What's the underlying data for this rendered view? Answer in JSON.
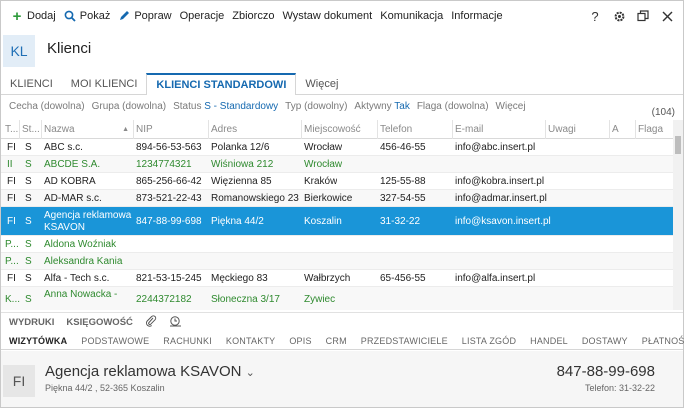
{
  "toolbar": {
    "add": "Dodaj",
    "show": "Pokaż",
    "fix": "Popraw",
    "operations": "Operacje",
    "bulk": "Zbiorczo",
    "issue": "Wystaw dokument",
    "communication": "Komunikacja",
    "info": "Informacje",
    "help": "?",
    "icons": [
      "plus-icon",
      "search-icon",
      "pencil-icon",
      "help-icon",
      "gear-icon",
      "restore-icon",
      "close-icon"
    ],
    "colors": {
      "add": "#2e9b3b",
      "accent": "#1569b0"
    }
  },
  "header": {
    "badge": "KL",
    "title": "Klienci"
  },
  "tabs": [
    {
      "label": "KLIENCI"
    },
    {
      "label": "MOI KLIENCI"
    },
    {
      "label": "KLIENCI STANDARDOWI"
    },
    {
      "label": "Więcej"
    }
  ],
  "filters": {
    "cecha": "Cecha (dowolna)",
    "grupa": "Grupa (dowolna)",
    "status_label": "Status",
    "status_value": "S - Standardowy",
    "typ": "Typ (dowolny)",
    "aktywny_label": "Aktywny",
    "aktywny_value": "Tak",
    "flaga": "Flaga (dowolna)",
    "more": "Więcej",
    "count": "(104)"
  },
  "columns": [
    "T...",
    "St...",
    "Nazwa",
    "NIP",
    "Adres",
    "Miejscowość",
    "Telefon",
    "E-mail",
    "Uwagi",
    "A",
    "Flaga"
  ],
  "rows": [
    {
      "t": "FI",
      "st": "S",
      "name": "ABC s.c.",
      "nip": "894-56-53-563",
      "addr": "Polanka  12/6",
      "city": "Wrocław",
      "tel": "456-46-55",
      "email": "info@abc.insert.pl"
    },
    {
      "t": "II",
      "st": "S",
      "name": "ABCDE S.A.",
      "nip": "1234774321",
      "addr": "Wiśniowa 212",
      "city": "Wrocław",
      "tel": "",
      "email": ""
    },
    {
      "t": "FI",
      "st": "S",
      "name": "AD KOBRA",
      "nip": "865-256-66-42",
      "addr": "Więzienna  85",
      "city": "Kraków",
      "tel": "125-55-88",
      "email": "info@kobra.insert.pl"
    },
    {
      "t": "FI",
      "st": "S",
      "name": "AD-MAR s.c.",
      "nip": "873-521-22-43",
      "addr": "Romanowskiego 23",
      "city": "Bierkowice",
      "tel": "327-54-55",
      "email": "info@admar.insert.pl"
    },
    {
      "t": "FI",
      "st": "S",
      "name": "Agencja reklamowa",
      "name2": "KSAVON",
      "nip": "847-88-99-698",
      "addr": "Piękna  44/2",
      "city": "Koszalin",
      "tel": "31-32-22",
      "email": "info@ksavon.insert.pl"
    },
    {
      "t": "P...",
      "st": "S",
      "name": "Aldona Woźniak",
      "nip": "",
      "addr": "",
      "city": "",
      "tel": "",
      "email": ""
    },
    {
      "t": "P...",
      "st": "S",
      "name": "Aleksandra Kania",
      "nip": "",
      "addr": "",
      "city": "",
      "tel": "",
      "email": ""
    },
    {
      "t": "FI",
      "st": "S",
      "name": "Alfa - Tech s.c.",
      "nip": "821-53-15-245",
      "addr": "Męckiego  83",
      "city": "Wałbrzych",
      "tel": "65-456-55",
      "email": "info@alfa.insert.pl"
    },
    {
      "t": "K...",
      "st": "S",
      "name": "Anna Nowacka -",
      "nip": "2244372182",
      "addr": "Słoneczna 3/17",
      "city": "Żywiec",
      "tel": "",
      "email": ""
    }
  ],
  "bottom": {
    "wydruki": "WYDRUKI",
    "ksiegowosc": "KSIĘGOWOŚĆ"
  },
  "detail_tabs": [
    "WIZYTÓWKA",
    "PODSTAWOWE",
    "RACHUNKI",
    "KONTAKTY",
    "OPIS",
    "CRM",
    "PRZEDSTAWICIELE",
    "LISTA ZGÓD",
    "HANDEL",
    "DOSTAWY",
    "PŁATNOŚCI"
  ],
  "detail": {
    "badge": "FI",
    "name": "Agencja reklamowa KSAVON",
    "address": "Piękna  44/2 , 52-365 Koszalin",
    "phone_big": "847-88-99-698",
    "phone": "Telefon: 31-32-22"
  }
}
